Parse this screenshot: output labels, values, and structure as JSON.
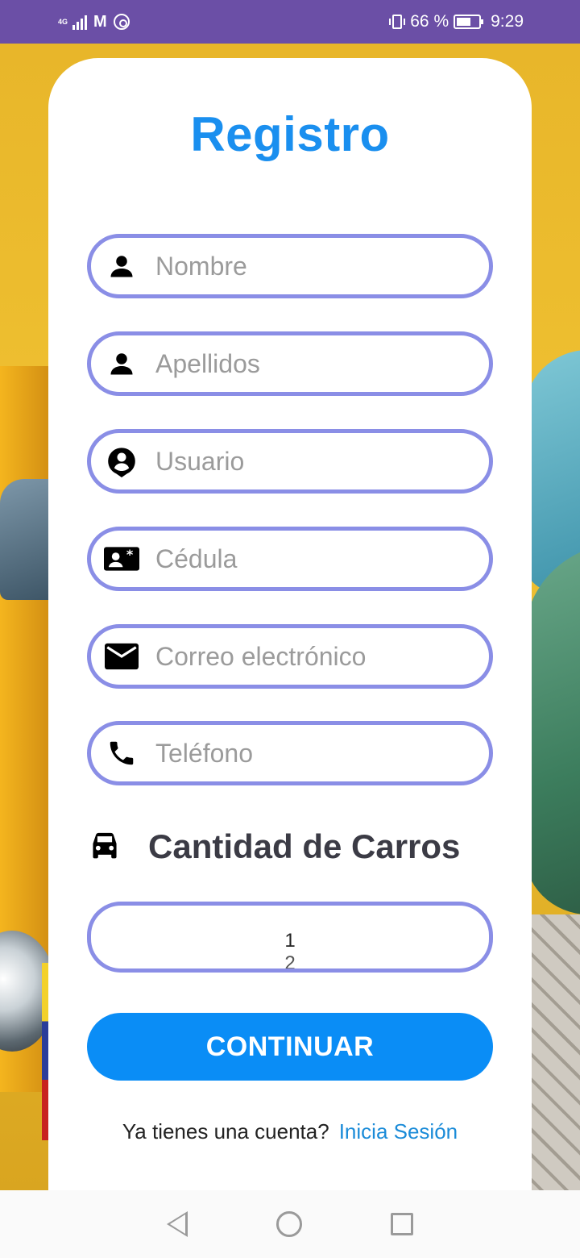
{
  "status_bar": {
    "network": "4G",
    "battery": "66 %",
    "battery_level": 0.66,
    "time": "9:29",
    "icons": [
      "signal-icon",
      "gmail-icon",
      "whatsapp-icon",
      "vibrate-icon",
      "battery-icon"
    ]
  },
  "form": {
    "title": "Registro",
    "fields": {
      "nombre": {
        "placeholder": "Nombre",
        "icon": "person-icon"
      },
      "apellidos": {
        "placeholder": "Apellidos",
        "icon": "person-icon"
      },
      "usuario": {
        "placeholder": "Usuario",
        "icon": "account-pin-icon"
      },
      "cedula": {
        "placeholder": "Cédula",
        "icon": "id-card-icon"
      },
      "correo": {
        "placeholder": "Correo electrónico",
        "icon": "email-icon"
      },
      "telefono": {
        "placeholder": "Teléfono",
        "icon": "phone-icon"
      }
    },
    "cars": {
      "label": "Cantidad de Carros",
      "icon": "car-icon",
      "options": [
        "1",
        "2"
      ]
    },
    "continue_label": "CONTINUAR",
    "login_prompt": "Ya tienes una cuenta?",
    "login_link": "Inicia Sesión"
  },
  "colors": {
    "status_bar": "#6b4fa6",
    "title": "#1a8fef",
    "field_border": "#8a8ee6",
    "button": "#0a8df6",
    "link": "#1a8bd8"
  }
}
